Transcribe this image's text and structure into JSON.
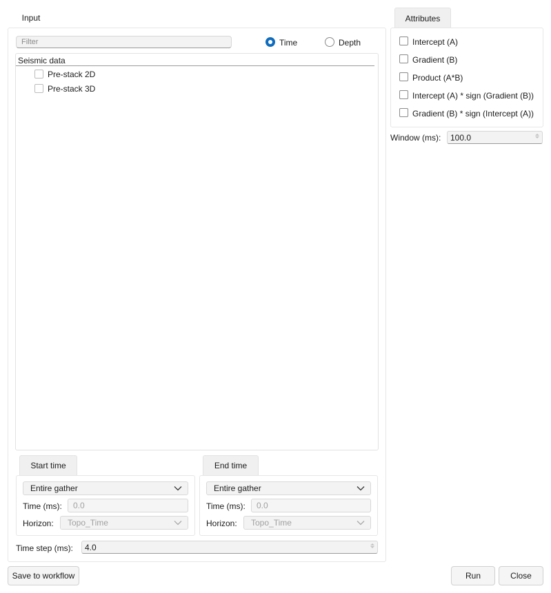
{
  "input": {
    "tab_label": "Input",
    "filter_placeholder": "Filter",
    "domain_options": [
      {
        "label": "Time",
        "selected": true
      },
      {
        "label": "Depth",
        "selected": false
      }
    ],
    "tree": {
      "header": "Seismic data",
      "items": [
        {
          "label": "Pre-stack 2D",
          "checked": false
        },
        {
          "label": "Pre-stack 3D",
          "checked": false
        }
      ]
    },
    "start_time": {
      "tab_label": "Start time",
      "mode": "Entire gather",
      "time_label": "Time (ms):",
      "time_value": "0.0",
      "horizon_label": "Horizon:",
      "horizon_value": "Topo_Time"
    },
    "end_time": {
      "tab_label": "End time",
      "mode": "Entire gather",
      "time_label": "Time (ms):",
      "time_value": "0.0",
      "horizon_label": "Horizon:",
      "horizon_value": "Topo_Time"
    },
    "time_step_label": "Time step (ms):",
    "time_step_value": "4.0"
  },
  "attributes": {
    "tab_label": "Attributes",
    "items": [
      {
        "label": "Intercept (A)",
        "checked": false
      },
      {
        "label": "Gradient (B)",
        "checked": false
      },
      {
        "label": "Product (A*B)",
        "checked": false
      },
      {
        "label": "Intercept (A) * sign (Gradient (B))",
        "checked": false
      },
      {
        "label": "Gradient (B) * sign (Intercept (A))",
        "checked": false
      }
    ],
    "window_label": "Window (ms):",
    "window_value": "100.0"
  },
  "footer": {
    "save_label": "Save to workflow",
    "run_label": "Run",
    "close_label": "Close"
  },
  "colors": {
    "accent": "#0f6cbd"
  }
}
